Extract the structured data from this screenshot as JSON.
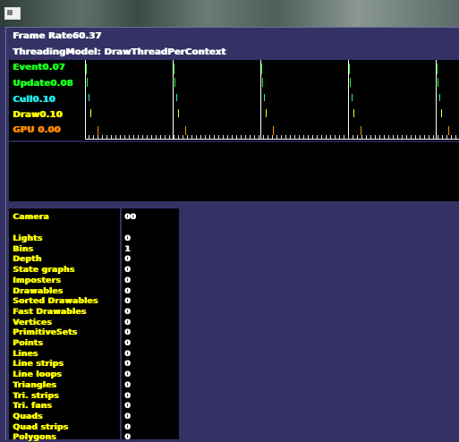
{
  "window": {
    "icon": "window-icon"
  },
  "stats": {
    "frame_rate": "Frame Rate60.37",
    "threading_model": "ThreadingModel: DrawThreadPerContext"
  },
  "timing": {
    "event": "Event0.07",
    "update": "Update0.08",
    "cull": "Cull0.10",
    "draw": "Draw0.10",
    "gpu": "GPU 0.00"
  },
  "scene": {
    "camera_label": "Camera",
    "camera_value": "00",
    "rows": [
      {
        "label": "Lights",
        "value": "0"
      },
      {
        "label": "Bins",
        "value": "1"
      },
      {
        "label": "Depth",
        "value": "0"
      },
      {
        "label": "State graphs",
        "value": "0"
      },
      {
        "label": "Imposters",
        "value": "0"
      },
      {
        "label": "Drawables",
        "value": "0"
      },
      {
        "label": "Sorted Drawables",
        "value": "0"
      },
      {
        "label": "Fast Drawables",
        "value": "0"
      },
      {
        "label": "Vertices",
        "value": "0"
      },
      {
        "label": "PrimitiveSets",
        "value": "0"
      },
      {
        "label": "Points",
        "value": "0"
      },
      {
        "label": "Lines",
        "value": "0"
      },
      {
        "label": "Line strips",
        "value": "0"
      },
      {
        "label": "Line loops",
        "value": "0"
      },
      {
        "label": "Triangles",
        "value": "0"
      },
      {
        "label": "Tri. strips",
        "value": "0"
      },
      {
        "label": "Tri. fans",
        "value": "0"
      },
      {
        "label": "Quads",
        "value": "0"
      },
      {
        "label": "Quad strips",
        "value": "0"
      },
      {
        "label": "Polygons",
        "value": "0"
      }
    ]
  },
  "colors": {
    "event": "#19ff19",
    "update": "#19ff19",
    "cull": "#1ee6e6",
    "draw": "#ffff00",
    "gpu": "#ff8c00",
    "frame_marker": "#ffffff"
  }
}
